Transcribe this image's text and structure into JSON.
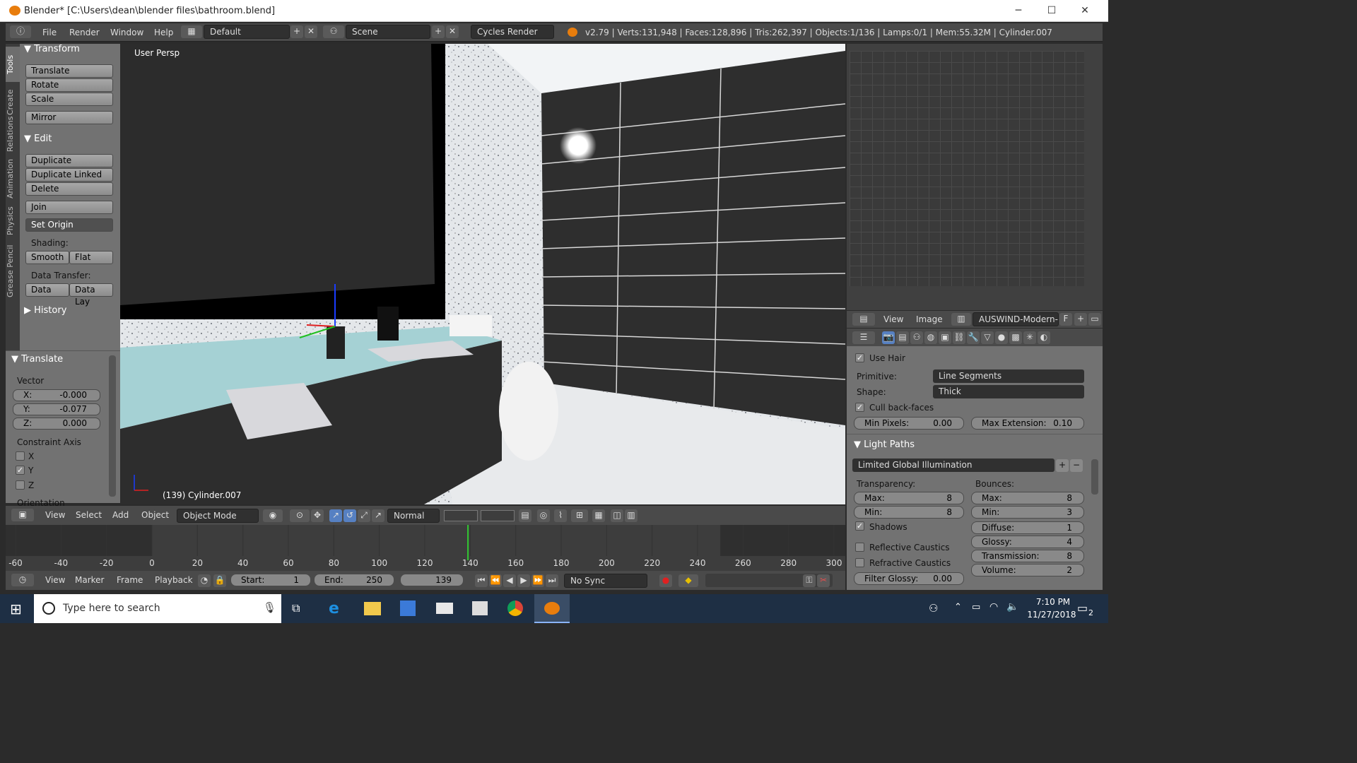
{
  "window": {
    "title": "Blender* [C:\\Users\\dean\\blender files\\bathroom.blend]",
    "min": "─",
    "max": "☐",
    "close": "✕"
  },
  "infobar": {
    "menus": [
      "File",
      "Render",
      "Window",
      "Help"
    ],
    "layout": "Default",
    "scene": "Scene",
    "engine": "Cycles Render",
    "stats": "v2.79 | Verts:131,948 | Faces:128,896 | Tris:262,397 | Objects:1/136 | Lamps:0/1 | Mem:55.32M | Cylinder.007"
  },
  "tool_tabs": [
    "Tools",
    "Create",
    "Relations",
    "Animation",
    "Physics",
    "Grease Pencil"
  ],
  "tools": {
    "transform_header": "Transform",
    "transform_buttons": [
      "Translate",
      "Rotate",
      "Scale",
      "Mirror"
    ],
    "edit_header": "Edit",
    "edit_buttons": [
      "Duplicate",
      "Duplicate Linked",
      "Delete",
      "Join"
    ],
    "set_origin": "Set Origin",
    "shading_label": "Shading:",
    "shading_buttons": [
      "Smooth",
      "Flat"
    ],
    "data_transfer_label": "Data Transfer:",
    "data_buttons": [
      "Data",
      "Data Lay"
    ],
    "history_header": "History"
  },
  "operator": {
    "header": "Translate",
    "vector_label": "Vector",
    "x_label": "X:",
    "x_value": "-0.000",
    "y_label": "Y:",
    "y_value": "-0.077",
    "z_label": "Z:",
    "z_value": "0.000",
    "constraint_label": "Constraint Axis",
    "axes": [
      "X",
      "Y",
      "Z"
    ],
    "axis_checked": [
      false,
      true,
      false
    ],
    "orientation_label": "Orientation"
  },
  "viewport": {
    "persp_label": "User Persp",
    "object_label": "(139) Cylinder.007"
  },
  "viewport_header": {
    "menus": [
      "View",
      "Select",
      "Add",
      "Object"
    ],
    "mode": "Object Mode",
    "orientation": "Normal"
  },
  "timeline": {
    "ticks": [
      "-60",
      "-40",
      "-20",
      "0",
      "20",
      "40",
      "60",
      "80",
      "100",
      "120",
      "140",
      "160",
      "180",
      "200",
      "220",
      "240",
      "260",
      "280",
      "300"
    ],
    "current_frame": 139,
    "frame_min": -60,
    "frame_max": 300
  },
  "timeline_header": {
    "menus": [
      "View",
      "Marker",
      "Frame",
      "Playback"
    ],
    "start_label": "Start:",
    "start_value": "1",
    "end_label": "End:",
    "end_value": "250",
    "frame_value": "139",
    "sync": "No Sync"
  },
  "image_editor": {
    "menus": [
      "View",
      "Image"
    ],
    "image_name": "AUSWIND-Modern-...",
    "fake_user": "F"
  },
  "properties": {
    "use_hair": "Use Hair",
    "primitive_label": "Primitive:",
    "primitive_value": "Line Segments",
    "shape_label": "Shape:",
    "shape_value": "Thick",
    "cull_backfaces": "Cull back-faces",
    "min_pixels_label": "Min Pixels:",
    "min_pixels_value": "0.00",
    "max_extension_label": "Max Extension:",
    "max_extension_value": "0.10",
    "light_paths_header": "Light Paths",
    "preset": "Limited Global Illumination",
    "transparency_label": "Transparency:",
    "t_max_label": "Max:",
    "t_max_value": "8",
    "t_min_label": "Min:",
    "t_min_value": "8",
    "shadows": "Shadows",
    "reflective_caustics": "Reflective Caustics",
    "refractive_caustics": "Refractive Caustics",
    "filter_glossy_label": "Filter Glossy:",
    "filter_glossy_value": "0.00",
    "bounces_label": "Bounces:",
    "b_max_label": "Max:",
    "b_max_value": "8",
    "b_min_label": "Min:",
    "b_min_value": "3",
    "diffuse_label": "Diffuse:",
    "diffuse_value": "1",
    "glossy_label": "Glossy:",
    "glossy_value": "4",
    "transmission_label": "Transmission:",
    "transmission_value": "8",
    "volume_label": "Volume:",
    "volume_value": "2"
  },
  "taskbar": {
    "search_placeholder": "Type here to search",
    "time": "7:10 PM",
    "date": "11/27/2018",
    "notification_count": "2"
  },
  "colors": {
    "blender_orange": "#e87d0d",
    "panel_grey": "#727272",
    "header_grey": "#4a4a4a",
    "frame_cursor": "#32c832"
  }
}
